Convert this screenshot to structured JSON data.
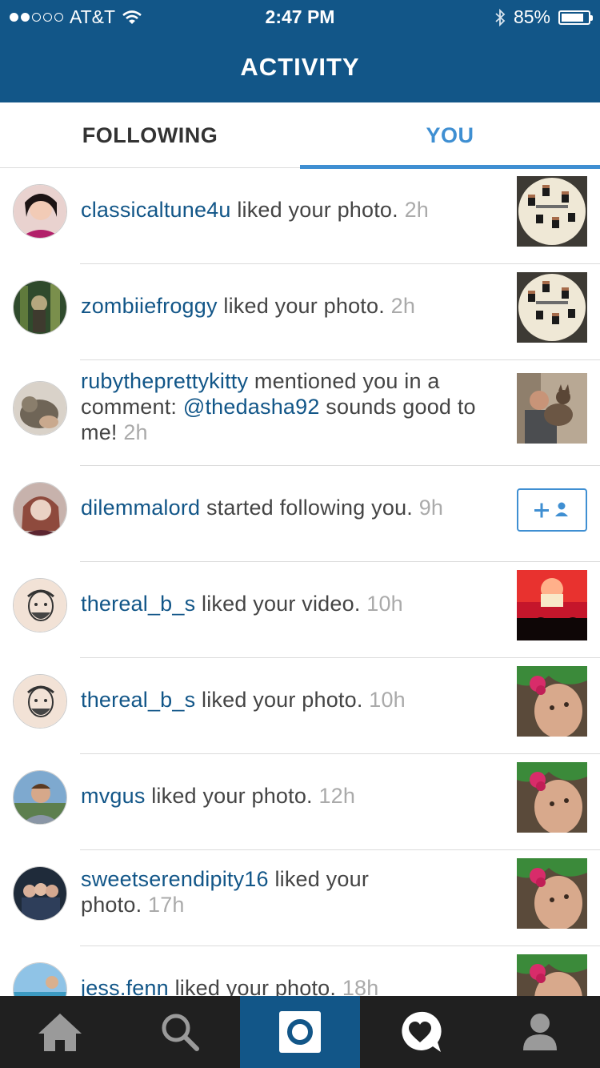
{
  "status_bar": {
    "carrier": "AT&T",
    "time": "2:47 PM",
    "battery": "85%",
    "battery_level": 0.85
  },
  "header": {
    "title": "ACTIVITY"
  },
  "tabs": {
    "following": "FOLLOWING",
    "you": "YOU",
    "active": "you"
  },
  "feed": [
    {
      "user": "classicaltune4u",
      "action": " liked your photo.",
      "time": "2h",
      "thumb": "cross-stitch-photo"
    },
    {
      "user": "zombiiefroggy",
      "action": " liked your photo.",
      "time": "2h",
      "thumb": "cross-stitch-photo"
    },
    {
      "user": "rubytheprettykitty",
      "action": " mentioned you in a comment: ",
      "mention": "@thedasha92",
      "action2": " sounds good to me!",
      "time": "2h",
      "thumb": "man-with-cat-photo"
    },
    {
      "user": "dilemmalord",
      "action": " started following you.",
      "time": "9h",
      "follow_icon": "follow-user-icon"
    },
    {
      "user": "thereal_b_s",
      "action": " liked your video.",
      "time": "10h",
      "thumb": "concert-video"
    },
    {
      "user": "thereal_b_s",
      "action": " liked your photo.",
      "time": "10h",
      "thumb": "selfie-flowers-photo"
    },
    {
      "user": "mvgus",
      "action": " liked your photo.",
      "time": "12h",
      "thumb": "selfie-flowers-photo"
    },
    {
      "user": "sweetserendipity16",
      "action": " liked your photo.",
      "time": "17h",
      "thumb": "selfie-flowers-photo"
    },
    {
      "user": "jess.fenn",
      "action": " liked your photo.",
      "time": "18h",
      "thumb": "selfie-flowers-photo"
    }
  ],
  "tab_bar": {
    "items": [
      "home-icon",
      "search-icon",
      "camera-icon",
      "activity-heart-icon",
      "profile-icon"
    ],
    "active": "camera-icon"
  },
  "colors": {
    "brand": "#125688",
    "accent": "#3f8fd2",
    "tab_bar": "#202020"
  }
}
